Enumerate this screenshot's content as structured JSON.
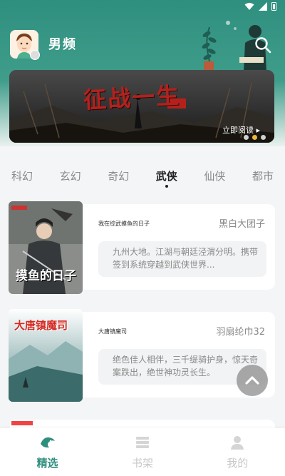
{
  "header": {
    "title": "男频",
    "accent": "#2f8f7f"
  },
  "banner": {
    "title": "征战一生",
    "cta": "立即阅读 ▸",
    "active_index": 1,
    "dot_count": 3
  },
  "tabs": [
    {
      "label": "科幻",
      "active": false
    },
    {
      "label": "玄幻",
      "active": false
    },
    {
      "label": "奇幻",
      "active": false
    },
    {
      "label": "武侠",
      "active": true
    },
    {
      "label": "仙侠",
      "active": false
    },
    {
      "label": "都市",
      "active": false
    }
  ],
  "books": [
    {
      "title": "我在综武摸鱼的日子",
      "author": "黑白大团子",
      "desc": "九州大地。江湖与朝廷泾渭分明。携带签到系统穿越到武侠世界...",
      "cover_title": "摸鱼的日子"
    },
    {
      "title": "大唐镇魔司",
      "author": "羽扇纶巾32",
      "desc": "绝色佳人相伴，三千缇骑护身，惊天奇案跌出，绝世神功灵长生。",
      "cover_title": "大唐镇魔司"
    }
  ],
  "bottom_nav": [
    {
      "label": "精选",
      "icon": "featured-icon",
      "active": true
    },
    {
      "label": "书架",
      "icon": "bookshelf-icon",
      "active": false
    },
    {
      "label": "我的",
      "icon": "profile-icon",
      "active": false
    }
  ]
}
